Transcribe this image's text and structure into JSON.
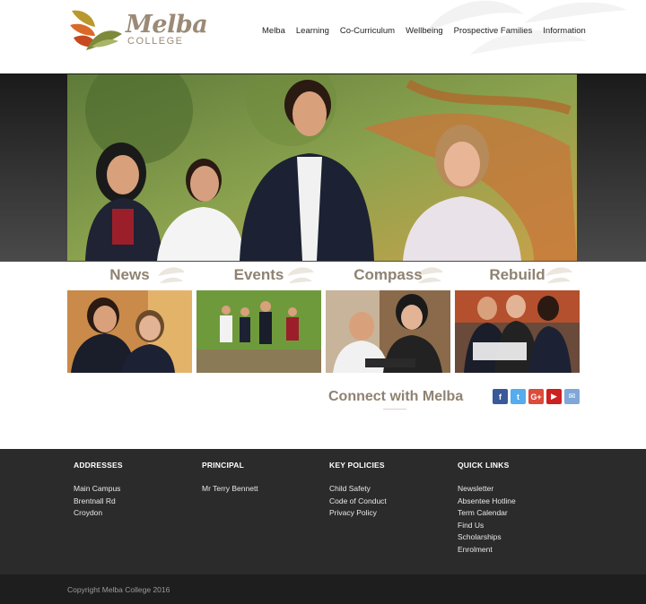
{
  "brand": {
    "name": "Melba",
    "sub": "COLLEGE"
  },
  "nav": [
    "Melba",
    "Learning",
    "Co-Curriculum",
    "Wellbeing",
    "Prospective Families",
    "Information"
  ],
  "tiles": [
    {
      "label": "News"
    },
    {
      "label": "Events"
    },
    {
      "label": "Compass"
    },
    {
      "label": "Rebuild"
    }
  ],
  "connect": {
    "title": "Connect with Melba"
  },
  "social": [
    {
      "icon": "facebook-icon",
      "glyph": "f",
      "color": "#3b5998"
    },
    {
      "icon": "twitter-icon",
      "glyph": "t",
      "color": "#55acee"
    },
    {
      "icon": "google-plus-icon",
      "glyph": "G+",
      "color": "#dd4b39"
    },
    {
      "icon": "youtube-icon",
      "glyph": "▶",
      "color": "#cd201f"
    },
    {
      "icon": "email-icon",
      "glyph": "✉",
      "color": "#7fa7d8"
    }
  ],
  "footer": {
    "addresses": {
      "title": "ADDRESSES",
      "links": [
        "Main Campus",
        "Brentnall Rd",
        "Croydon"
      ]
    },
    "principal": {
      "title": "PRINCIPAL",
      "links": [
        "Mr Terry Bennett"
      ]
    },
    "policies": {
      "title": "KEY POLICIES",
      "links": [
        "Child Safety",
        "Code of Conduct",
        "Privacy Policy"
      ]
    },
    "quick": {
      "title": "QUICK LINKS",
      "links": [
        "Newsletter",
        "Absentee Hotline",
        "Term Calendar",
        "Find Us",
        "Scholarships",
        "Enrolment"
      ]
    }
  },
  "copyright": "Copyright Melba College 2016"
}
